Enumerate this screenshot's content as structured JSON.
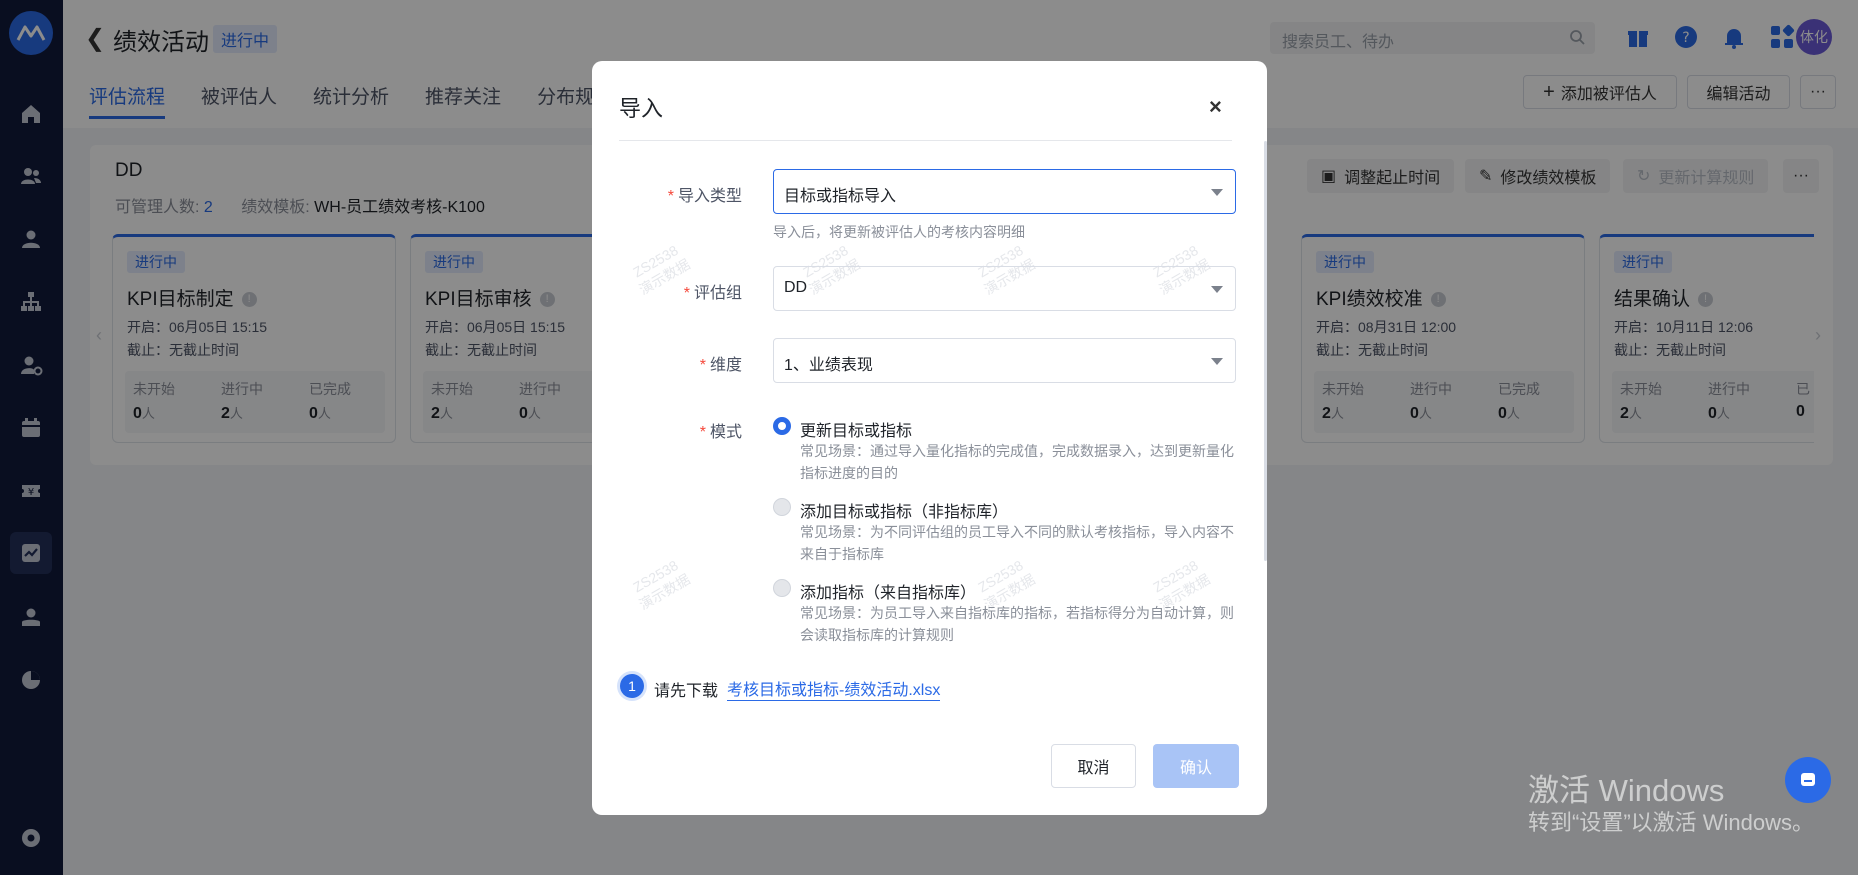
{
  "sidebar": {
    "logo": "app-logo",
    "items": [
      {
        "icon": "home-icon"
      },
      {
        "icon": "team-icon"
      },
      {
        "icon": "person-icon"
      },
      {
        "icon": "org-chart-icon"
      },
      {
        "icon": "person-settings-icon"
      },
      {
        "icon": "calendar-icon"
      },
      {
        "icon": "ticket-icon"
      },
      {
        "icon": "performance-icon"
      },
      {
        "icon": "user-icon"
      },
      {
        "icon": "pie-chart-icon"
      },
      {
        "icon": "settings-icon"
      }
    ]
  },
  "header": {
    "back_glyph": "❮",
    "title": "绩效活动",
    "status": "进行中",
    "search_placeholder": "搜索员工、待办",
    "avatar_text": "体化",
    "tabs": [
      {
        "label": "评估流程",
        "active": true
      },
      {
        "label": "被评估人",
        "active": false
      },
      {
        "label": "统计分析",
        "active": false
      },
      {
        "label": "推荐关注",
        "active": false
      },
      {
        "label": "分布规则",
        "active": false
      }
    ],
    "add_evaluatee": "添加被评估人",
    "edit_activity": "编辑活动",
    "more": "···"
  },
  "panel": {
    "name": "DD",
    "managers_label": "可管理人数:",
    "managers_value": "2",
    "template_label": "绩效模板:",
    "template_value": "WH-员工绩效考核-K100",
    "adjust_time": "调整起止时间",
    "modify_template": "修改绩效模板",
    "update_rules": "更新计算规则",
    "more": "···",
    "stages": [
      {
        "tag": "进行中",
        "name": "KPI目标制定",
        "start": "开启：06月05日 15:15",
        "end": "截止：无截止时间",
        "s1_label": "未开始",
        "s1": "0",
        "s2_label": "进行中",
        "s2": "2",
        "s3_label": "已完成",
        "s3": "0",
        "unit": "人"
      },
      {
        "tag": "进行中",
        "name": "KPI目标审核",
        "start": "开启：06月05日 15:15",
        "end": "截止：无截止时间",
        "s1_label": "未开始",
        "s1": "2",
        "s2_label": "进行中",
        "s2": "0",
        "s3_label": "",
        "s3": "",
        "unit": "人"
      },
      {
        "tag": "进行中",
        "name": "KPI绩效校准",
        "start": "开启：08月31日 12:00",
        "end": "截止：无截止时间",
        "s1_label": "未开始",
        "s1": "2",
        "s2_label": "进行中",
        "s2": "0",
        "s3_label": "已完成",
        "s3": "0",
        "unit": "人"
      },
      {
        "tag": "进行中",
        "name": "结果确认",
        "start": "开启：10月11日 12:06",
        "end": "截止：无截止时间",
        "s1_label": "未开始",
        "s1": "2",
        "s2_label": "进行中",
        "s2": "0",
        "s3_label": "已",
        "s3": "0",
        "unit": "人"
      }
    ]
  },
  "modal": {
    "title": "导入",
    "close": "×",
    "import_type_label": "导入类型",
    "import_type_value": "目标或指标导入",
    "import_type_hint": "导入后，将更新被评估人的考核内容明细",
    "group_label": "评估组",
    "group_value": "DD",
    "dimension_label": "维度",
    "dimension_value": "1、业绩表现",
    "mode_label": "模式",
    "modes": [
      {
        "label": "更新目标或指标",
        "desc": "常见场景：通过导入量化指标的完成值，完成数据录入，达到更新量化指标进度的目的",
        "selected": true
      },
      {
        "label": "添加目标或指标（非指标库）",
        "desc": "常见场景：为不同评估组的员工导入不同的默认考核指标，导入内容不来自于指标库",
        "selected": false
      },
      {
        "label": "添加指标（来自指标库）",
        "desc": "常见场景：为员工导入来自指标库的指标，若指标得分为自动计算，则会读取指标库的计算规则",
        "selected": false
      }
    ],
    "step_num": "1",
    "step_text": "请先下载",
    "download_link": "考核目标或指标-绩效活动.xlsx",
    "cancel": "取消",
    "confirm": "确认",
    "watermark_line1": "ZS2538",
    "watermark_line2": "演示数据"
  },
  "windows": {
    "activate_title": "激活 Windows",
    "activate_sub": "转到“设置”以激活 Windows。"
  },
  "colors": {
    "sidebar_bg": "#111a3b",
    "accent": "#2b6ae6",
    "required": "#f5483b",
    "overlay": "rgba(0,0,0,0.45)"
  }
}
